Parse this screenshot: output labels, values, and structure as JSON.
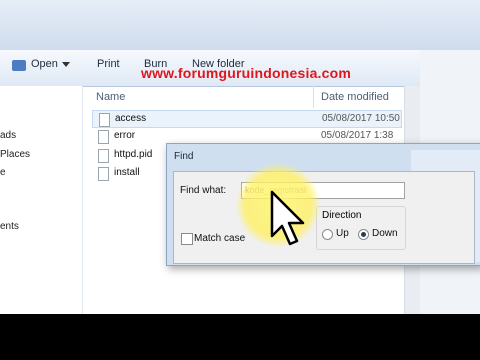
{
  "toolbar": {
    "open_label": "Open",
    "print_label": "Print",
    "burn_label": "Burn",
    "new_folder_label": "New folder"
  },
  "watermark": "www.forumguruindonesia.com",
  "nav": {
    "items": [
      "ads",
      "Places",
      "e",
      "",
      "ents"
    ]
  },
  "file_list": {
    "columns": {
      "name": "Name",
      "date": "Date modified"
    },
    "rows": [
      {
        "name": "access",
        "date": "05/08/2017 10:50"
      },
      {
        "name": "error",
        "date": "05/08/2017 1:38"
      },
      {
        "name": "httpd.pid",
        "date": ""
      },
      {
        "name": "install",
        "date": ""
      }
    ]
  },
  "find_dialog": {
    "title": "Find",
    "find_what_label": "Find what:",
    "find_value": "kode_registrasi",
    "match_case_label": "Match case",
    "direction_label": "Direction",
    "up_label": "Up",
    "down_label": "Down",
    "direction_selected": "Down"
  }
}
